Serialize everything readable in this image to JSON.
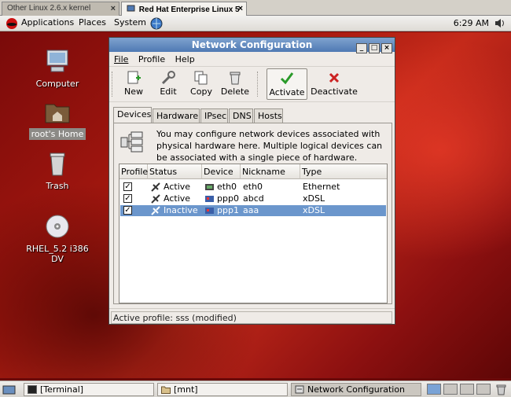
{
  "vm_tabs": [
    {
      "label": "Other Linux 2.6.x kernel",
      "close": "×"
    },
    {
      "label": "Red Hat Enterprise Linux 5",
      "close": "×"
    }
  ],
  "top_panel": {
    "menus": [
      "Applications",
      "Places",
      "System"
    ],
    "clock": "6:29 AM"
  },
  "desktop_icons": [
    {
      "label": "Computer",
      "icon": "computer-icon"
    },
    {
      "label": "root's Home",
      "icon": "home-folder-icon"
    },
    {
      "label": "Trash",
      "icon": "trash-icon"
    },
    {
      "label": "RHEL_5.2 i386 DV",
      "icon": "dvd-icon"
    }
  ],
  "window": {
    "title": "Network Configuration",
    "menu": [
      "File",
      "Profile",
      "Help"
    ],
    "toolbar": {
      "new": "New",
      "edit": "Edit",
      "copy": "Copy",
      "delete": "Delete",
      "activate": "Activate",
      "deactivate": "Deactivate"
    },
    "tabs": [
      "Devices",
      "Hardware",
      "IPsec",
      "DNS",
      "Hosts"
    ],
    "description": "You may configure network devices associated with physical hardware here.  Multiple logical devices can be associated with a single piece of hardware.",
    "columns": [
      "Profile",
      "Status",
      "Device",
      "Nickname",
      "Type"
    ],
    "rows": [
      {
        "checked": "✓",
        "status": "Active",
        "device": "eth0",
        "nickname": "eth0",
        "type": "Ethernet"
      },
      {
        "checked": "✓",
        "status": "Active",
        "device": "ppp0",
        "nickname": "abcd",
        "type": "xDSL"
      },
      {
        "checked": "✓",
        "status": "Inactive",
        "device": "ppp1",
        "nickname": "aaa",
        "type": "xDSL"
      }
    ],
    "status": "Active profile: sss (modified)"
  },
  "bottom_panel": {
    "tasks": [
      "[Terminal]",
      "[mnt]",
      "Network Configuration"
    ]
  },
  "colors": {
    "selection": "#6b96cc",
    "titlebar": "#4f79b3",
    "desktop_red": "#c42a1a"
  }
}
